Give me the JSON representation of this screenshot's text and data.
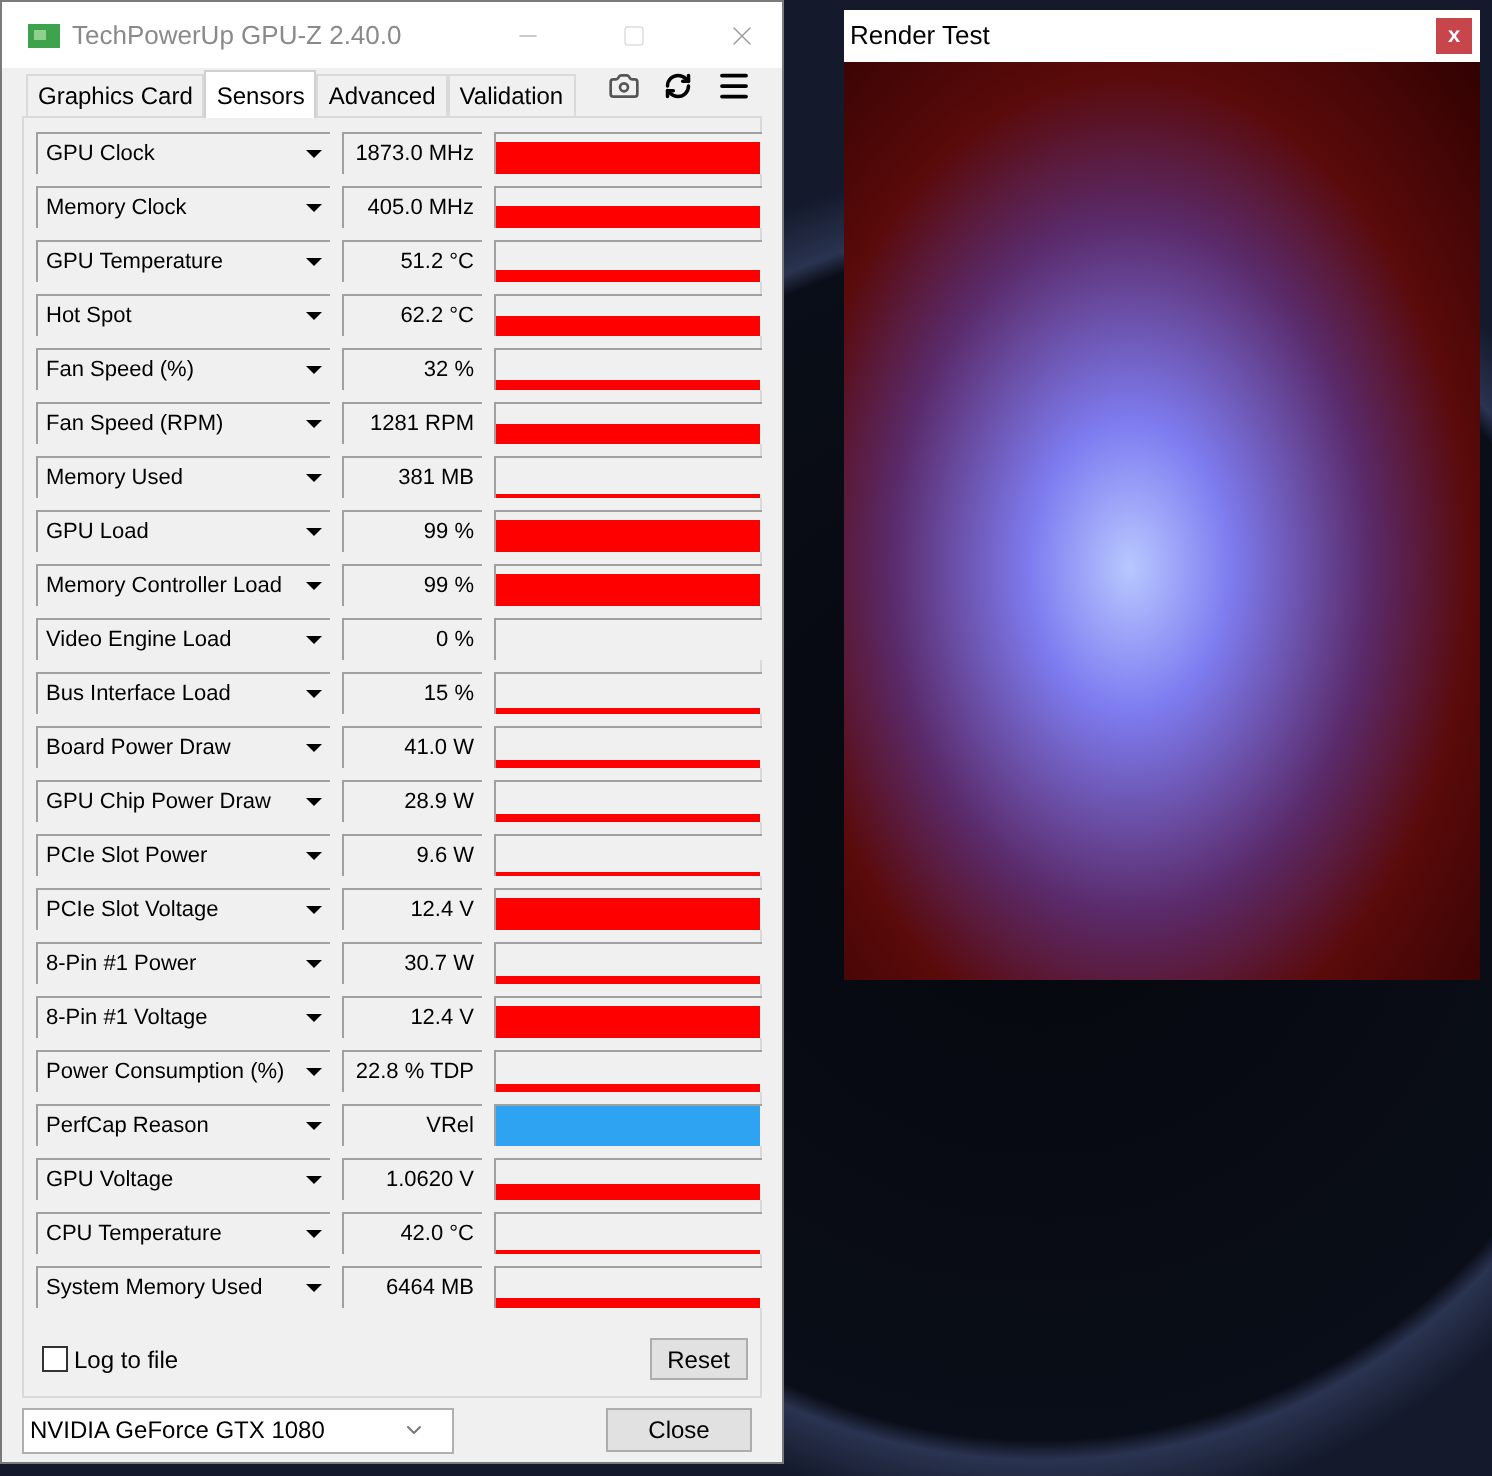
{
  "gpuz_window": {
    "title": "TechPowerUp GPU-Z 2.40.0",
    "tabs": [
      {
        "label": "Graphics Card",
        "selected": false
      },
      {
        "label": "Sensors",
        "selected": true
      },
      {
        "label": "Advanced",
        "selected": false
      },
      {
        "label": "Validation",
        "selected": false
      }
    ],
    "sensors": [
      {
        "name": "GPU Clock",
        "value": "1873.0 MHz",
        "kind": "graph"
      },
      {
        "name": "Memory Clock",
        "value": "405.0 MHz",
        "kind": "graph"
      },
      {
        "name": "GPU Temperature",
        "value": "51.2 °C",
        "kind": "graph"
      },
      {
        "name": "Hot Spot",
        "value": "62.2 °C",
        "kind": "graph"
      },
      {
        "name": "Fan Speed (%)",
        "value": "32 %",
        "kind": "graph"
      },
      {
        "name": "Fan Speed (RPM)",
        "value": "1281 RPM",
        "kind": "graph"
      },
      {
        "name": "Memory Used",
        "value": "381 MB",
        "kind": "graph"
      },
      {
        "name": "GPU Load",
        "value": "99 %",
        "kind": "graph"
      },
      {
        "name": "Memory Controller Load",
        "value": "99 %",
        "kind": "graph"
      },
      {
        "name": "Video Engine Load",
        "value": "0 %",
        "kind": "graph"
      },
      {
        "name": "Bus Interface Load",
        "value": "15 %",
        "kind": "graph"
      },
      {
        "name": "Board Power Draw",
        "value": "41.0 W",
        "kind": "graph"
      },
      {
        "name": "GPU Chip Power Draw",
        "value": "28.9 W",
        "kind": "graph"
      },
      {
        "name": "PCIe Slot Power",
        "value": "9.6 W",
        "kind": "graph"
      },
      {
        "name": "PCIe Slot Voltage",
        "value": "12.4 V",
        "kind": "graph"
      },
      {
        "name": "8-Pin #1 Power",
        "value": "30.7 W",
        "kind": "graph"
      },
      {
        "name": "8-Pin #1 Voltage",
        "value": "12.4 V",
        "kind": "graph"
      },
      {
        "name": "Power Consumption (%)",
        "value": "22.8 % TDP",
        "kind": "graph"
      },
      {
        "name": "PerfCap Reason",
        "value": "VRel",
        "kind": "status"
      },
      {
        "name": "GPU Voltage",
        "value": "1.0620 V",
        "kind": "graph"
      },
      {
        "name": "CPU Temperature",
        "value": "42.0 °C",
        "kind": "graph"
      },
      {
        "name": "System Memory Used",
        "value": "6464 MB",
        "kind": "graph"
      }
    ],
    "log_to_file": {
      "label": "Log to file",
      "checked": false
    },
    "reset_button": "Reset",
    "gpu_select": "NVIDIA GeForce GTX 1080",
    "close_button": "Close"
  },
  "render_window": {
    "title": "Render Test",
    "close": "x"
  }
}
